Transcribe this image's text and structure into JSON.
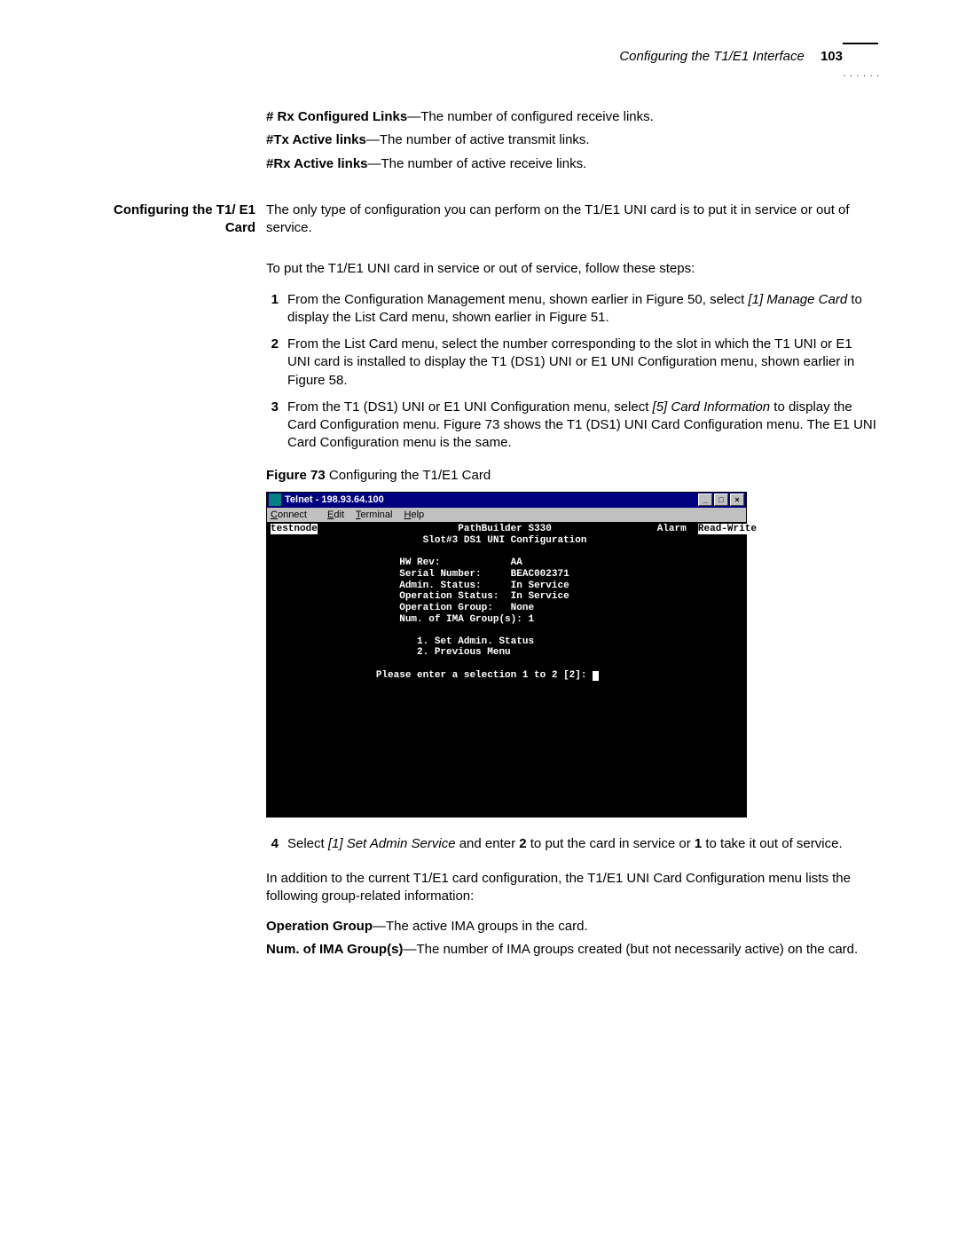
{
  "header": {
    "section": "Configuring the T1/E1 Interface",
    "page": "103"
  },
  "definitions_top": [
    {
      "term": "# Rx Configured Links",
      "desc": "—The number of configured receive links."
    },
    {
      "term": "#Tx Active links",
      "desc": "—The number of active transmit links."
    },
    {
      "term": "#Rx Active links",
      "desc": "—The number of active receive links."
    }
  ],
  "sidehead": "Configuring the T1/ E1 Card",
  "intro1": "The only type of configuration you can perform on the T1/E1 UNI card is to put it in service or out of service.",
  "intro2": "To put the T1/E1 UNI card in service or out of service, follow these steps:",
  "steps123": [
    {
      "pre": "From the Configuration Management menu, shown earlier in Figure 50, select ",
      "em": "[1] Manage Card",
      "post": " to display the List Card menu, shown earlier in Figure 51."
    },
    {
      "pre": "From the List Card menu, select the number corresponding to the slot in which the T1 UNI or E1 UNI card is installed to display the T1 (DS1) UNI or E1 UNI Configuration menu, shown earlier in Figure 58.",
      "em": "",
      "post": ""
    },
    {
      "pre": "From the T1 (DS1) UNI or E1 UNI Configuration menu, select ",
      "em": "[5] Card Information",
      "post": " to display the Card Configuration menu. Figure 73 shows the T1 (DS1) UNI Card Configuration menu. The E1 UNI Card Configuration menu is the same."
    }
  ],
  "figure": {
    "label": "Figure 73",
    "caption": "   Configuring the T1/E1 Card"
  },
  "telnet": {
    "title": "Telnet - 198.93.64.100",
    "menus": {
      "connect": "Connect",
      "edit": "Edit",
      "terminal": "Terminal",
      "help": "Help"
    },
    "node": "testnode",
    "header1": "PathBuilder S330",
    "alarm": "Alarm",
    "rw": "Read-Write",
    "header2": "Slot#3 DS1 UNI Configuration",
    "rows": {
      "hwrev_l": "HW Rev:",
      "hwrev_v": "AA",
      "serial_l": "Serial Number:",
      "serial_v": "BEAC002371",
      "admin_l": "Admin. Status:",
      "admin_v": "In Service",
      "oper_l": "Operation Status:",
      "oper_v": "In Service",
      "group_l": "Operation Group:",
      "group_v": "None",
      "ima": "Num. of IMA Group(s): 1"
    },
    "opt1": "1. Set Admin. Status",
    "opt2": "2. Previous Menu",
    "prompt": "Please enter a selection 1 to 2 [2]: "
  },
  "step4": {
    "pre": "Select ",
    "em": "[1] Set Admin Service",
    "mid": " and enter ",
    "b1": "2",
    "mid2": " to put the card in service or ",
    "b2": "1",
    "post": " to take it out of service."
  },
  "tail_para": "In addition to the current T1/E1 card configuration, the T1/E1 UNI Card Configuration menu lists the following group-related information:",
  "definitions_bottom": [
    {
      "term": "Operation Group",
      "desc": "—The active IMA groups in the card."
    },
    {
      "term": "Num. of IMA Group(s)",
      "desc": "—The number of IMA groups created (but not necessarily active) on the card."
    }
  ]
}
